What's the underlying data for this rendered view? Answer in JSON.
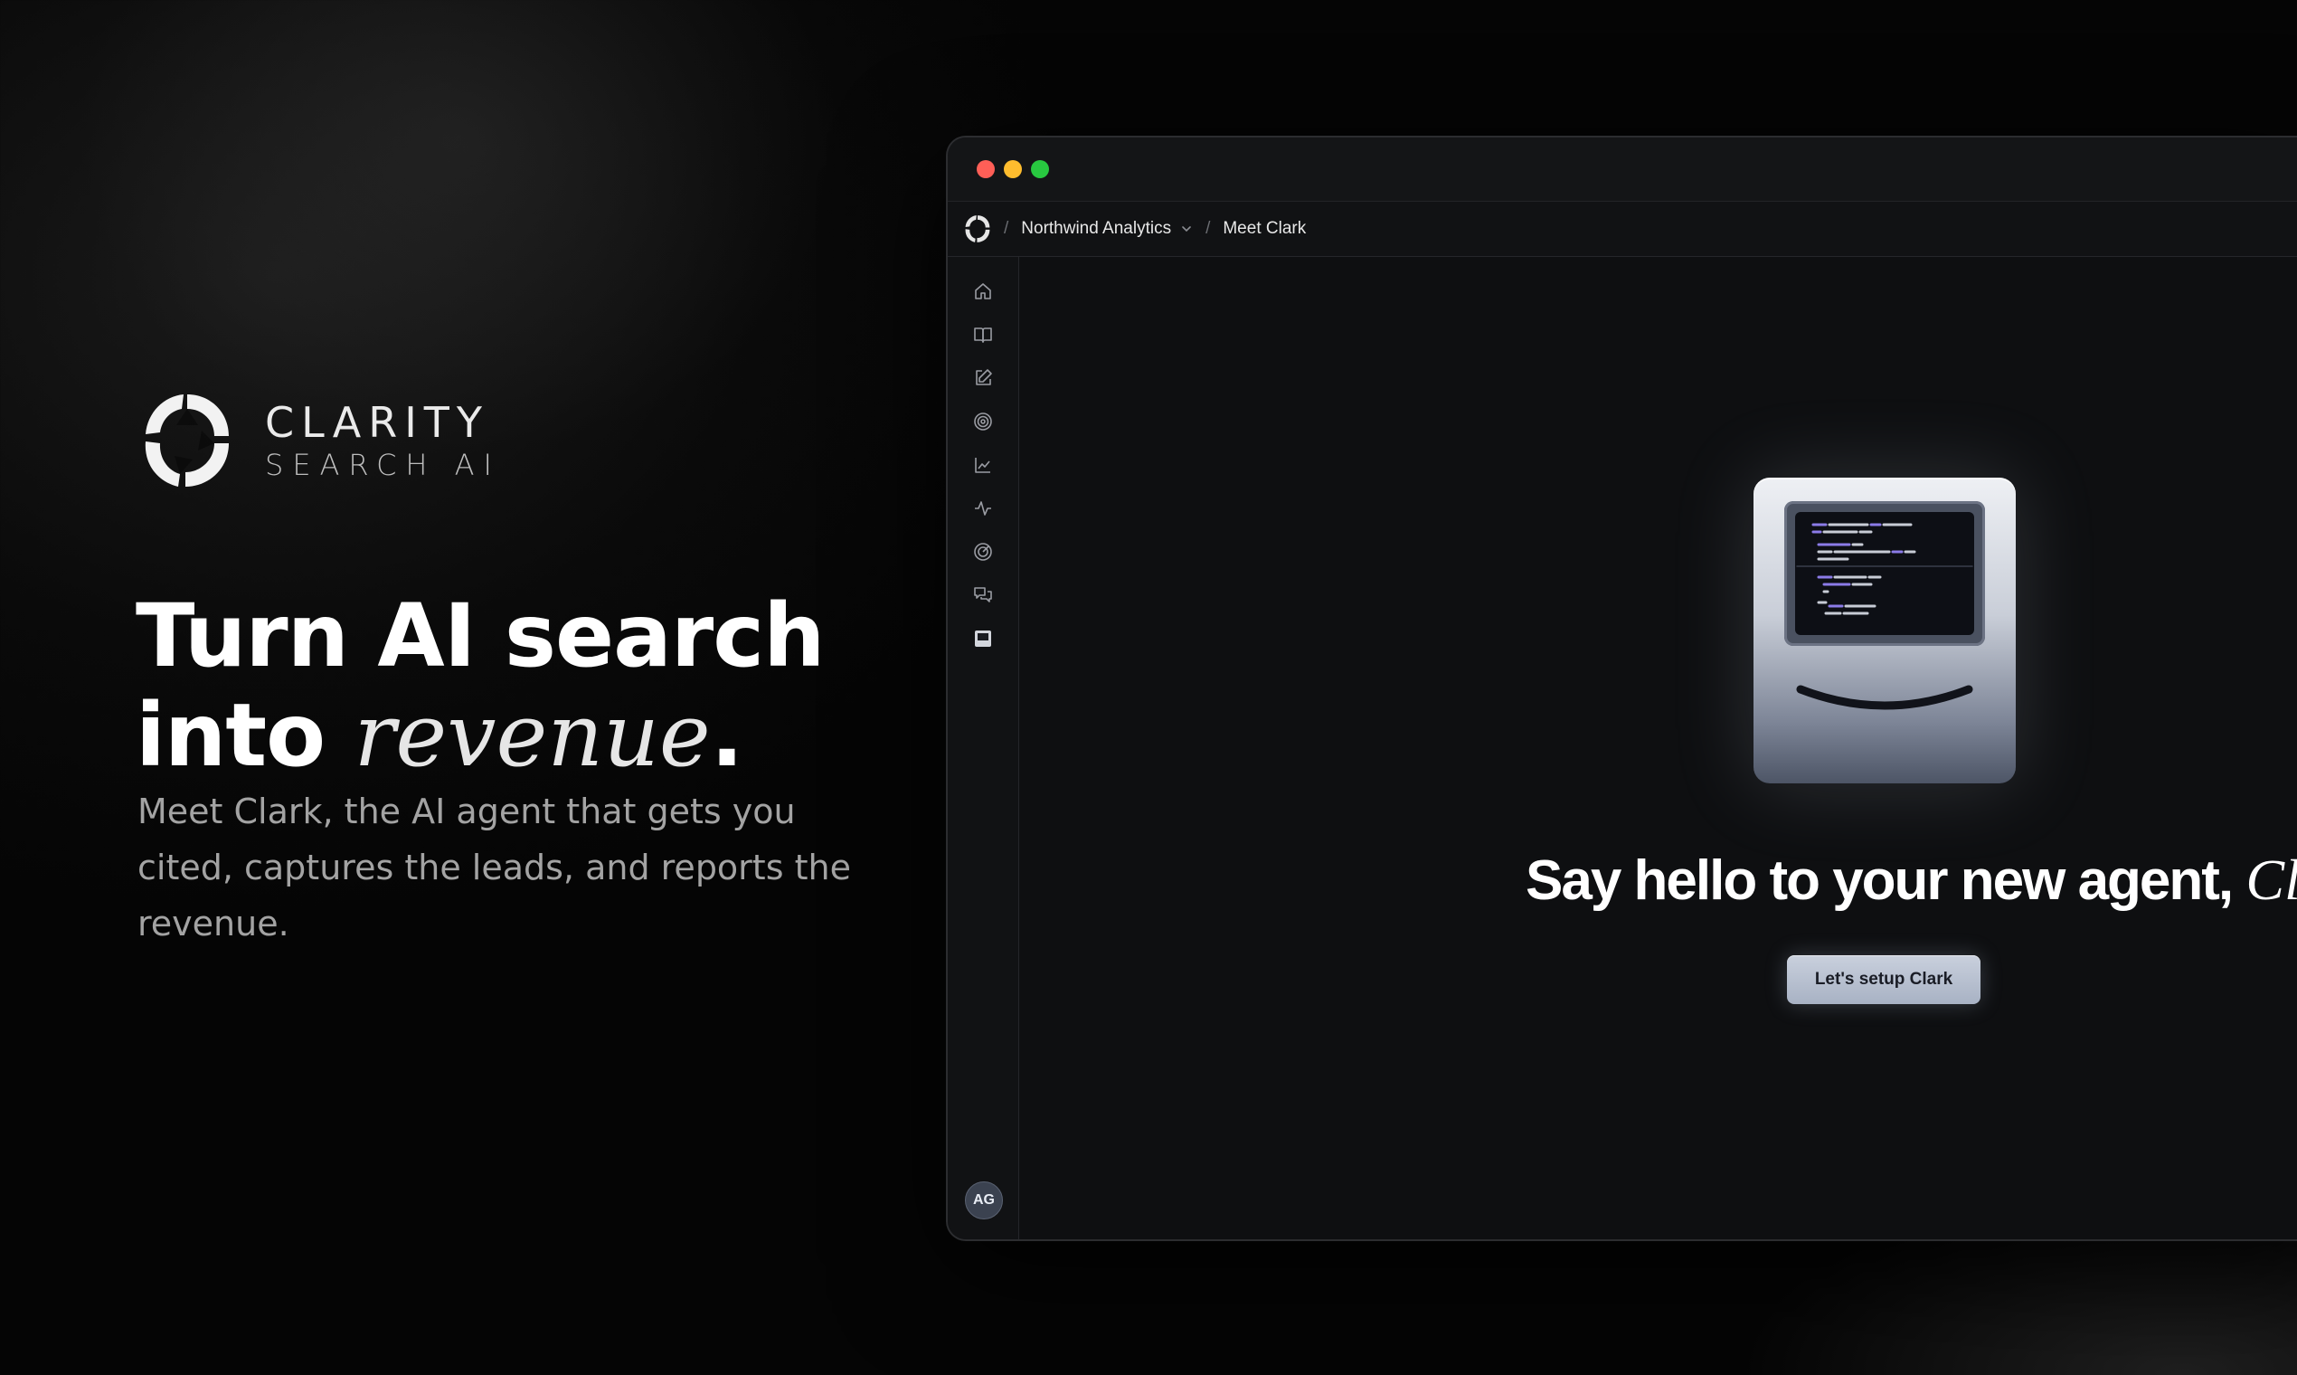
{
  "brand": {
    "name": "CLARITY",
    "sub": "SEARCH AI"
  },
  "headline": {
    "line1": "Turn AI search",
    "line2_prefix": "into ",
    "line2_accent": "revenue",
    "line2_suffix": "."
  },
  "subcopy": "Meet Clark, the AI agent that gets you cited, captures the leads, and reports the revenue.",
  "window": {
    "breadcrumb": {
      "org": "Northwind Analytics",
      "page": "Meet Clark",
      "separator": "/"
    },
    "sidebar": {
      "items": [
        {
          "icon": "home-icon"
        },
        {
          "icon": "book-icon"
        },
        {
          "icon": "edit-icon"
        },
        {
          "icon": "target-icon"
        },
        {
          "icon": "chart-icon"
        },
        {
          "icon": "activity-icon"
        },
        {
          "icon": "radar-icon"
        },
        {
          "icon": "messages-icon"
        },
        {
          "icon": "panel-icon"
        }
      ],
      "avatar_initials": "AG"
    },
    "hero": {
      "title_prefix": "Say hello to your new agent, ",
      "title_name": "Clark",
      "title_suffix": ".",
      "cta_label": "Let's setup Clark"
    }
  },
  "colors": {
    "background": "#060606",
    "window": "#0e0f11",
    "cta": "#b8c1d1",
    "close": "#ff5f57",
    "minimize": "#febc2e",
    "maximize": "#28c840"
  }
}
